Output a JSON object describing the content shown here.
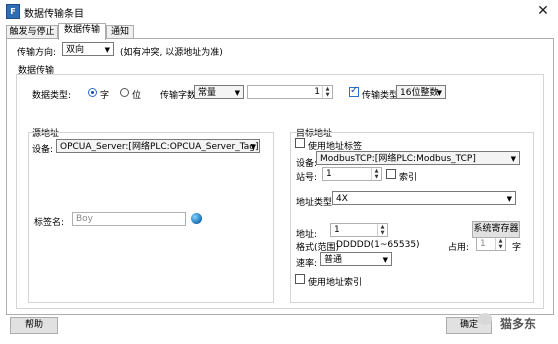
{
  "window": {
    "title": "数据传输条目",
    "app_icon": "F",
    "close_glyph": "✕"
  },
  "tabs": [
    {
      "label": "触发与停止"
    },
    {
      "label": "数据传输",
      "active": true
    },
    {
      "label": "通知"
    }
  ],
  "direction": {
    "label": "传输方向:",
    "value": "双向",
    "note": "(如有冲突, 以源地址为准)"
  },
  "data_transfer": {
    "legend": "数据传输",
    "data_type_label": "数据类型:",
    "radio_word": "字",
    "radio_bit": "位",
    "selected": "字",
    "word_count_label": "传输字数",
    "word_count_mode": "常量",
    "word_count_value": "1",
    "transfer_type_checked": true,
    "transfer_type_label": "传输类型",
    "transfer_type_value": "16位整数"
  },
  "source": {
    "legend": "源地址",
    "device_label": "设备:",
    "device_value": "OPCUA_Server:[网络PLC:OPCUA_Server_Tag]",
    "tag_label": "标签名:",
    "tag_value": "Boy"
  },
  "target": {
    "legend": "目标地址",
    "use_tag_label": "使用地址标签",
    "use_tag_checked": false,
    "device_label": "设备:",
    "device_value": "ModbusTCP:[网络PLC:Modbus_TCP]",
    "station_label": "站号:",
    "station_value": "1",
    "index_label": "索引",
    "index_checked": false,
    "addr_type_label": "地址类型:",
    "addr_type_value": "4X",
    "address_label": "地址:",
    "address_value": "1",
    "sys_reg_button": "系统寄存器",
    "format_label": "格式(范围)",
    "format_value": "DDDDD(1~65535)",
    "occupy_label": "占用:",
    "occupy_value": "1",
    "occupy_unit": "字",
    "rate_label": "速率:",
    "rate_value": "普通",
    "use_index_label": "使用地址索引",
    "use_index_checked": false
  },
  "footer": {
    "help_button": "帮助",
    "ok_button": "确定",
    "watermark": "猫多东"
  },
  "colors": {
    "accent": "#1a4e9e",
    "border": "#adadad",
    "button_bg": "#e1e1e1"
  },
  "icons": {
    "app": "app-icon",
    "close": "close-icon",
    "browse": "globe-browse-icon",
    "dropdown": "chevron-down-icon",
    "spin": "spin-arrows-icon",
    "watermark": "wechat-icon"
  }
}
